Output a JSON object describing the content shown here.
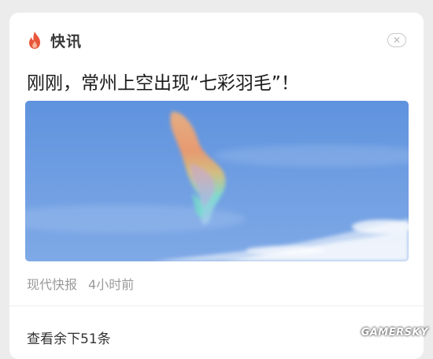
{
  "header": {
    "icon": "flame-icon",
    "title": "快讯",
    "close_icon": "close-icon",
    "accent_color": "#e8563a"
  },
  "news": {
    "headline": "刚刚，常州上空出现“七彩羽毛”！",
    "image": {
      "sky_color": "#6f9ee0",
      "cloud_colors": [
        "#f4a06a",
        "#e8c07a",
        "#7ee2d2",
        "#c9a6e6"
      ]
    },
    "source": "现代快报",
    "time": "4小时前"
  },
  "footer": {
    "more_label": "查看余下51条"
  },
  "watermark": "GAMERSKY"
}
